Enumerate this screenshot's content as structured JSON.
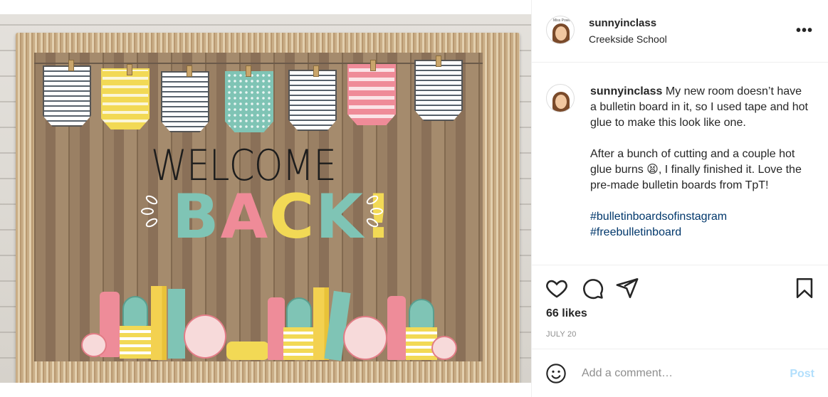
{
  "header": {
    "username": "sunnyinclass",
    "location": "Creekside School",
    "more_label": "•••",
    "avatar_tag": "Miss Powers"
  },
  "image": {
    "welcome": "WELCOME",
    "back_letters": [
      "B",
      "A",
      "C",
      "K",
      "!"
    ],
    "back_colors": [
      "#7fc4b5",
      "#ef8b98",
      "#f2d955",
      "#7fc4b5",
      "#f2d955"
    ]
  },
  "caption": {
    "username": "sunnyinclass",
    "paragraph1": "My new room doesn’t have a bulletin board in it, so I used tape and hot glue to make this look like one.",
    "paragraph2": "After a bunch of cutting and a couple hot glue burns 😫, I finally finished it. Love the pre-made bulletin boards from TpT!",
    "hashtag1": "#bulletinboardsofinstagram",
    "hashtag2": "#freebulletinboard"
  },
  "actions": {
    "likes": "66 likes",
    "date": "JULY 20"
  },
  "comment": {
    "placeholder": "Add a comment…",
    "post_label": "Post"
  },
  "colors": {
    "link": "#00376b",
    "muted": "#8e8e8e",
    "post_disabled": "#b2dffc"
  }
}
